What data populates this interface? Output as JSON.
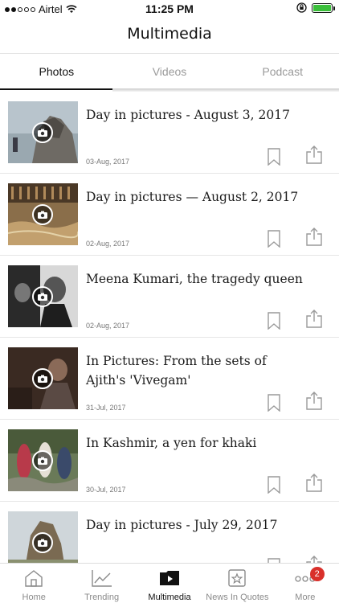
{
  "status_bar": {
    "carrier": "Airtel",
    "time": "11:25 PM",
    "battery_level": 1.0,
    "battery_color": "#3bbf3b"
  },
  "header": {
    "title": "Multimedia"
  },
  "tabs": [
    {
      "label": "Photos",
      "active": true
    },
    {
      "label": "Videos",
      "active": false
    },
    {
      "label": "Podcast",
      "active": false
    }
  ],
  "items": [
    {
      "title": "Day in pictures - August 3, 2017",
      "date": "03-Aug, 2017",
      "icon": "camera-icon"
    },
    {
      "title": "Day in pictures — August 2, 2017",
      "date": "02-Aug, 2017",
      "icon": "camera-icon"
    },
    {
      "title": "Meena Kumari, the tragedy queen",
      "date": "02-Aug, 2017",
      "icon": "camera-icon"
    },
    {
      "title": "In Pictures: From the sets of Ajith's 'Vivegam'",
      "date": "31-Jul, 2017",
      "icon": "camera-icon"
    },
    {
      "title": "In Kashmir, a yen for khaki",
      "date": "30-Jul, 2017",
      "icon": "camera-icon"
    },
    {
      "title": "Day in pictures - July 29, 2017",
      "date": "",
      "icon": "camera-icon"
    }
  ],
  "bottom_nav": [
    {
      "label": "Home",
      "icon": "home-icon",
      "active": false
    },
    {
      "label": "Trending",
      "icon": "trending-icon",
      "active": false
    },
    {
      "label": "Multimedia",
      "icon": "multimedia-icon",
      "active": true
    },
    {
      "label": "News In Quotes",
      "icon": "quotes-icon",
      "active": false
    },
    {
      "label": "More",
      "icon": "more-icon",
      "active": false,
      "badge": "2"
    }
  ],
  "colors": {
    "accent": "#111111",
    "badge": "#d9302b",
    "inactive": "#9a9a9a"
  }
}
